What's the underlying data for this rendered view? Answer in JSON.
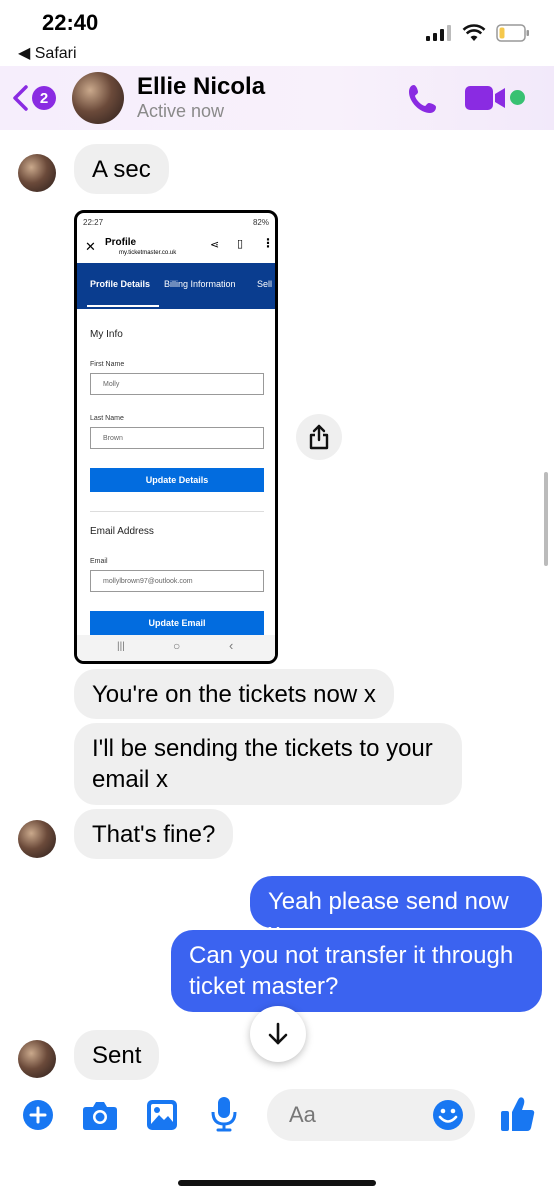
{
  "status_bar": {
    "time": "22:40",
    "back_app": "◀ Safari"
  },
  "header": {
    "unread_count": "2",
    "contact_name": "Ellie Nicola",
    "contact_status": "Active now"
  },
  "messages": [
    {
      "text": "A sec"
    },
    {
      "text": "You're on the tickets now x"
    },
    {
      "text": "I'll be sending the tickets to your email x"
    },
    {
      "text": "That's fine?"
    },
    {
      "text": "Yeah please send now x"
    },
    {
      "text": "Can you not transfer it through ticket master?"
    },
    {
      "text": "Sent"
    }
  ],
  "shared_screenshot": {
    "status_time": "22:27",
    "battery": "82%",
    "page_title": "Profile",
    "url": "my.ticketmaster.co.uk",
    "tabs": [
      "Profile Details",
      "Billing Information",
      "Sell"
    ],
    "my_info_title": "My Info",
    "first_name_label": "First Name",
    "first_name_value": "Molly",
    "last_name_label": "Last Name",
    "last_name_value": "Brown",
    "update_details": "Update Details",
    "email_title": "Email Address",
    "email_label": "Email",
    "email_value": "mollylbrown97@outlook.com",
    "update_email": "Update Email"
  },
  "composer": {
    "placeholder": "Aa"
  },
  "colors": {
    "accent_purple": "#8a2be2",
    "outgoing_bubble": "#3b63f0",
    "incoming_bubble": "#efefef",
    "composer_icons": "#1877f2",
    "online": "#38c172"
  },
  "icons": [
    "back-chevron-icon",
    "phone-icon",
    "video-camera-icon",
    "share-icon",
    "arrow-down-icon",
    "plus-icon",
    "camera-icon",
    "gallery-icon",
    "microphone-icon",
    "emoji-icon",
    "thumbs-up-icon"
  ]
}
